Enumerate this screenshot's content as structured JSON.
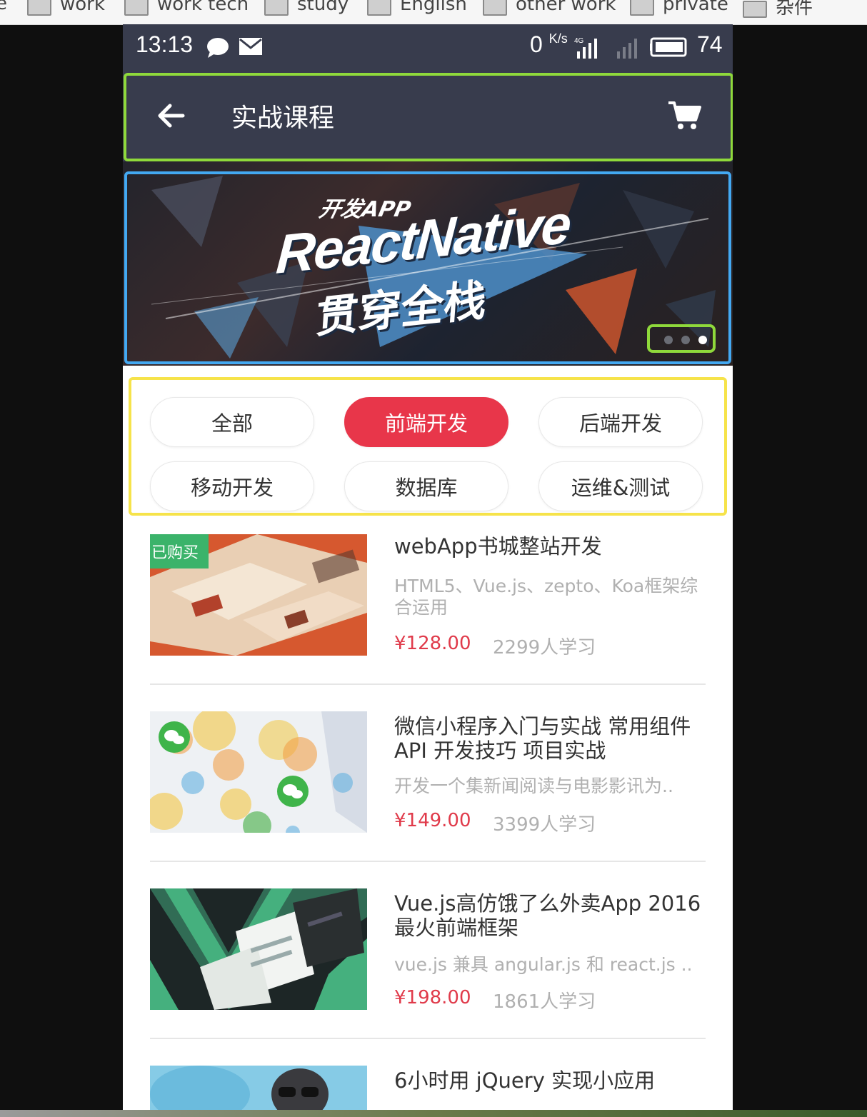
{
  "bookmarks": [
    {
      "label": "work"
    },
    {
      "label": "work tech"
    },
    {
      "label": "study"
    },
    {
      "label": "English"
    },
    {
      "label": "other work"
    },
    {
      "label": "private"
    },
    {
      "label": "杂件"
    }
  ],
  "status_bar": {
    "time": "13:13",
    "net_speed": "0",
    "net_unit": "K/s",
    "battery": "74",
    "icons": [
      "chat-bubble-icon",
      "mail-icon",
      "signal-4g-icon",
      "signal-empty-icon",
      "battery-icon"
    ]
  },
  "nav": {
    "title": "实战课程",
    "back_icon": "arrow-left-icon",
    "cart_icon": "cart-icon",
    "frame_color": "#8fd93b"
  },
  "banner": {
    "small_text": "开发APP",
    "main_text": "ReactNative",
    "sub_text": "贯穿全栈",
    "slide_count": 3,
    "active_slide": 3,
    "frame_color": "#43a9f2"
  },
  "categories": {
    "items": [
      {
        "label": "全部",
        "active": false
      },
      {
        "label": "前端开发",
        "active": true
      },
      {
        "label": "后端开发",
        "active": false
      },
      {
        "label": "移动开发",
        "active": false
      },
      {
        "label": "数据库",
        "active": false
      },
      {
        "label": "运维&测试",
        "active": false
      }
    ],
    "accent": "#e8364a",
    "frame_color": "#f6e34a"
  },
  "courses": [
    {
      "badge": "已购买",
      "title": "webApp书城整站开发",
      "desc": "HTML5、Vue.js、zepto、Koa框架综合运用",
      "price": "¥128.00",
      "learners": "2299人学习"
    },
    {
      "title": "微信小程序入门与实战 常用组件 API 开发技巧 项目实战",
      "desc": "开发一个集新闻阅读与电影影讯为..",
      "price": "¥149.00",
      "learners": "3399人学习"
    },
    {
      "title": "Vue.js高仿饿了么外卖App 2016最火前端框架",
      "desc": "vue.js 兼具 angular.js 和 react.js ..",
      "price": "¥198.00",
      "learners": "1861人学习"
    },
    {
      "title": "6小时用 jQuery 实现小应用"
    }
  ]
}
